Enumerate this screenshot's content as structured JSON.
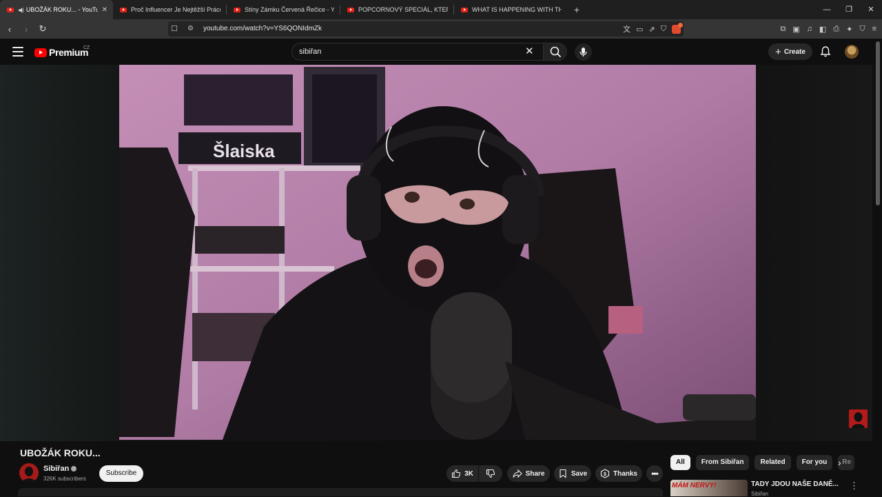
{
  "browser": {
    "tabs": [
      {
        "title": "UBOŽÁK ROKU... - YouTube",
        "active": true,
        "audio": true
      },
      {
        "title": "Proč Influencer Je Nejtěžší Práce? - Y",
        "active": false
      },
      {
        "title": "Stíny Zámku Červená Řečice - YouTul",
        "active": false
      },
      {
        "title": "POPCORNOVÝ SPECIÁL, KTERÝ JE NE",
        "active": false
      },
      {
        "title": "WHAT IS HAPPENING WITH THE USA",
        "active": false
      }
    ],
    "url": "youtube.com/watch?v=YS6QONIdmZk"
  },
  "youtube": {
    "logo_text": "Premium",
    "logo_country": "CZ",
    "search_value": "sibiřan",
    "create_label": "Create"
  },
  "video": {
    "title": "UBOŽÁK ROKU...",
    "channel": "Sibiřan",
    "subscribers": "326K subscribers",
    "subscribe_label": "Subscribe",
    "likes": "3K",
    "share_label": "Share",
    "save_label": "Save",
    "thanks_label": "Thanks",
    "scene_text": "Šlaiska"
  },
  "sidebar": {
    "chips": [
      "All",
      "From Sibiřan",
      "Related",
      "For you",
      "Re"
    ],
    "recommendation": {
      "thumb_text": "MÁM NERVY!",
      "title": "TADY JDOU NAŠE DANĚ...",
      "channel": "Sibiřan"
    }
  }
}
